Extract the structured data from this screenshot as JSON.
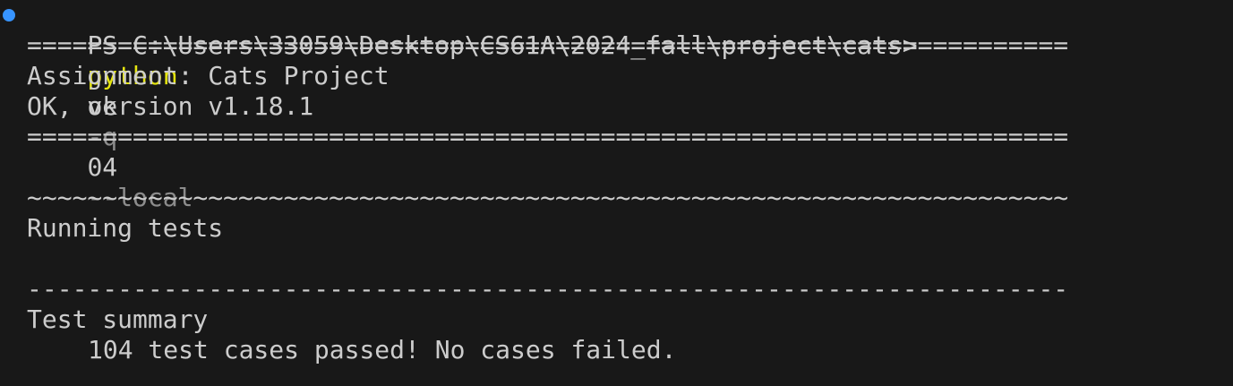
{
  "prompt": {
    "path": "PS C:\\Users\\33059\\Desktop\\CS61A\\2024_fall\\project\\cats>",
    "command": "python",
    "args": [
      "ok",
      "-q",
      "04",
      "--local"
    ]
  },
  "output": {
    "separator_eq": "=====================================================================",
    "assignment": "Assignment: Cats Project",
    "version": "OK, version v1.18.1",
    "separator_tilde": "~~~~~~~~~~~~~~~~~~~~~~~~~~~~~~~~~~~~~~~~~~~~~~~~~~~~~~~~~~~~~~~~~~~~~",
    "running": "Running tests",
    "separator_dash": "---------------------------------------------------------------------",
    "summary_title": "Test summary",
    "summary_result": "104 test cases passed! No cases failed."
  },
  "colors": {
    "background": "#181818",
    "text": "#cccccc",
    "command": "#e5e510",
    "option": "#8c8c8c",
    "status_dot": "#3794ff"
  }
}
